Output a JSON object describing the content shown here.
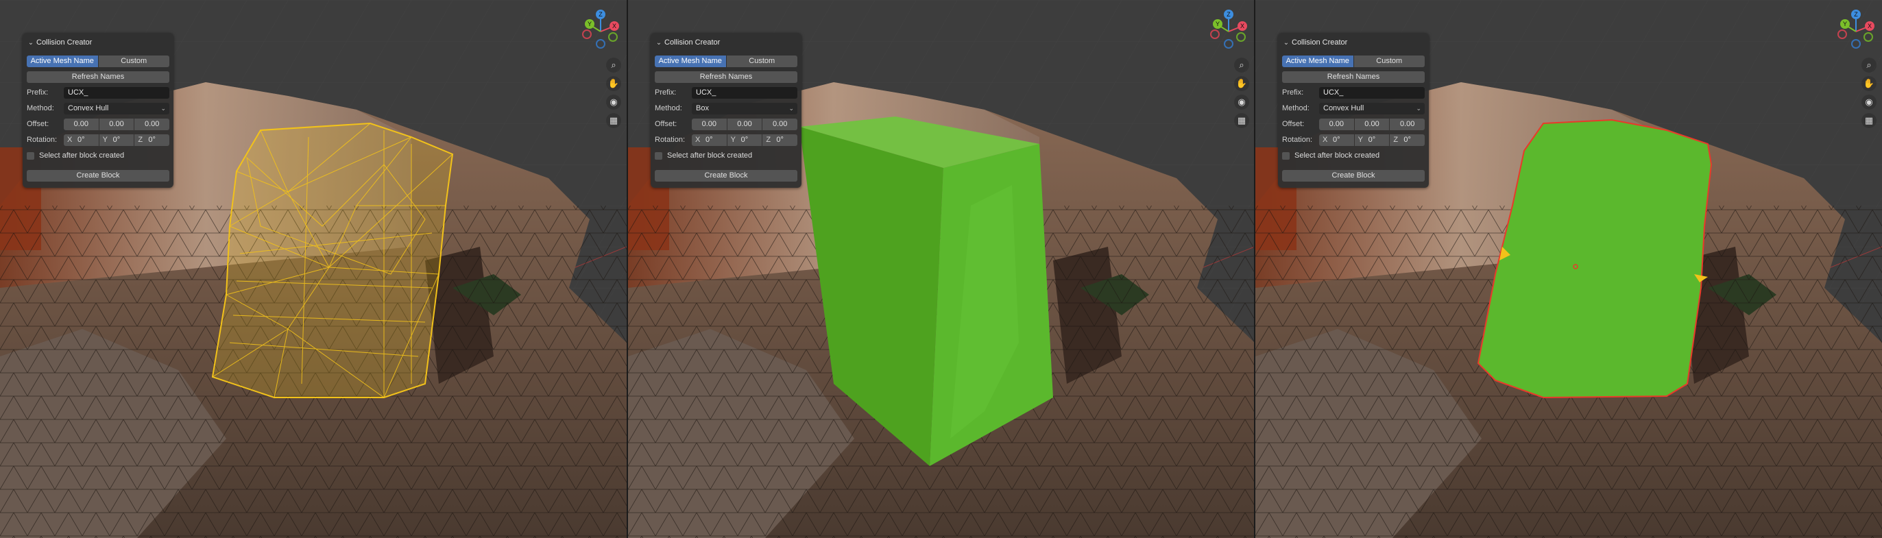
{
  "panels": [
    {
      "title": "Collision Creator",
      "tabs": [
        "Active Mesh Name",
        "Custom"
      ],
      "active_tab": "Active Mesh Name",
      "refresh_label": "Refresh Names",
      "prefix_label": "Prefix:",
      "prefix_value": "UCX_",
      "method_label": "Method:",
      "method_value": "Convex Hull",
      "offset_label": "Offset:",
      "offset_values": [
        "0.00",
        "0.00",
        "0.00"
      ],
      "rotation_label": "Rotation:",
      "rotation_axes": [
        "X",
        "Y",
        "Z"
      ],
      "rotation_values": [
        "0°",
        "0°",
        "0°"
      ],
      "checkbox_label": "Select after block created",
      "create_label": "Create Block"
    },
    {
      "title": "Collision Creator",
      "tabs": [
        "Active Mesh Name",
        "Custom"
      ],
      "active_tab": "Active Mesh Name",
      "refresh_label": "Refresh Names",
      "prefix_label": "Prefix:",
      "prefix_value": "UCX_",
      "method_label": "Method:",
      "method_value": "Box",
      "offset_label": "Offset:",
      "offset_values": [
        "0.00",
        "0.00",
        "0.00"
      ],
      "rotation_label": "Rotation:",
      "rotation_axes": [
        "X",
        "Y",
        "Z"
      ],
      "rotation_values": [
        "0°",
        "0°",
        "0°"
      ],
      "checkbox_label": "Select after block created",
      "create_label": "Create Block"
    },
    {
      "title": "Collision Creator",
      "tabs": [
        "Active Mesh Name",
        "Custom"
      ],
      "active_tab": "Active Mesh Name",
      "refresh_label": "Refresh Names",
      "prefix_label": "Prefix:",
      "prefix_value": "UCX_",
      "method_label": "Method:",
      "method_value": "Convex Hull",
      "offset_label": "Offset:",
      "offset_values": [
        "0.00",
        "0.00",
        "0.00"
      ],
      "rotation_label": "Rotation:",
      "rotation_axes": [
        "X",
        "Y",
        "Z"
      ],
      "rotation_values": [
        "0°",
        "0°",
        "0°"
      ],
      "checkbox_label": "Select after block created",
      "create_label": "Create Block"
    }
  ],
  "gizmo": {
    "z": "Z",
    "y": "Y",
    "x": "X"
  },
  "nav_icons": [
    "zoom-icon",
    "hand-pan-icon",
    "camera-icon",
    "perspective-grid-icon"
  ],
  "colors": {
    "accent": "#4772b3",
    "wireframe_selected": "#f2c21a",
    "collision_green": "#5bb82d",
    "axis_x": "#e84a5f",
    "axis_y": "#7bbf2a",
    "axis_z": "#3d8ee0"
  }
}
